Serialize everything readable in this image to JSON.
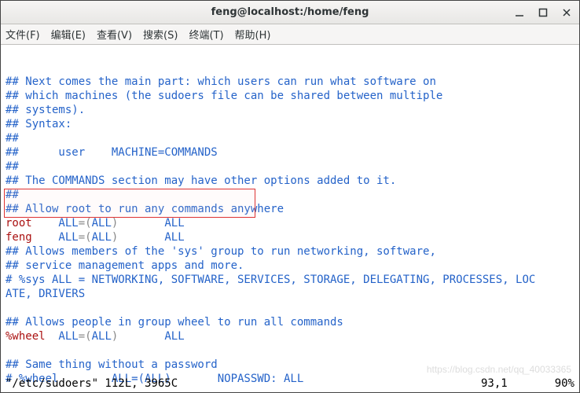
{
  "window": {
    "title": "feng@localhost:/home/feng"
  },
  "menu": {
    "file": "文件(F)",
    "edit": "编辑(E)",
    "view": "查看(V)",
    "search": "搜索(S)",
    "terminal": "终端(T)",
    "help": "帮助(H)"
  },
  "lines": {
    "l1": "## Next comes the main part: which users can run what software on",
    "l2": "## which machines (the sudoers file can be shared between multiple",
    "l3": "## systems).",
    "l4": "## Syntax:",
    "l5": "##",
    "l6": "##      user    MACHINE=COMMANDS",
    "l7": "##",
    "l8": "## The COMMANDS section may have other options added to it.",
    "l9": "##",
    "l10": "## Allow root to run any commands anywhere",
    "root_user": "root",
    "root_rest_a": "    ALL",
    "root_eq": "=",
    "root_paren_l": "(",
    "root_all": "ALL",
    "root_paren_r": ")",
    "root_tail": "       ALL",
    "feng_user": "feng",
    "feng_rest_a": "    ALL",
    "feng_eq": "=",
    "feng_paren_l": "(",
    "feng_all": "ALL",
    "feng_paren_r": ")",
    "feng_tail": "       ALL",
    "l13": "## Allows members of the 'sys' group to run networking, software,",
    "l14": "## service management apps and more.",
    "l15": "# %sys ALL = NETWORKING, SOFTWARE, SERVICES, STORAGE, DELEGATING, PROCESSES, LOC",
    "l15b": "ATE, DRIVERS",
    "l17": "## Allows people in group wheel to run all commands",
    "wheel_user": "%wheel",
    "wheel_rest_a": "  ALL",
    "wheel_eq": "=",
    "wheel_paren_l": "(",
    "wheel_all": "ALL",
    "wheel_paren_r": ")",
    "wheel_tail": "       ALL",
    "l20": "## Same thing without a password",
    "l21": "# %wheel        ALL=(ALL)       NOPASSWD: ALL"
  },
  "status": {
    "left": "\"/etc/sudoers\" 112L, 3965C",
    "pos": "93,1",
    "pct": "90%"
  },
  "watermark": "https://blog.csdn.net/qq_40033365"
}
